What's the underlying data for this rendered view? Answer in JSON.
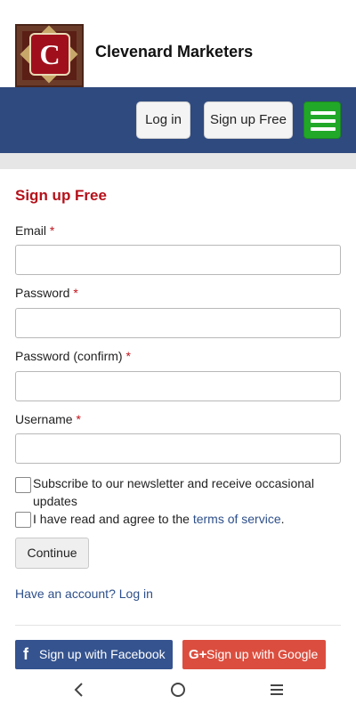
{
  "header": {
    "logo_letter": "C",
    "brand": "Clevenard Marketers",
    "login_label": "Log in",
    "signup_label": "Sign up Free"
  },
  "form": {
    "title": "Sign up Free",
    "required_mark": "*",
    "email_label": "Email",
    "password_label": "Password",
    "password_confirm_label": "Password (confirm)",
    "username_label": "Username",
    "email_value": "",
    "password_value": "",
    "password_confirm_value": "",
    "username_value": "",
    "newsletter_label": "Subscribe to our newsletter and receive occasional updates",
    "terms_prefix": "I have read and agree to the ",
    "terms_link": "terms of service",
    "terms_suffix": ".",
    "continue_label": "Continue",
    "have_account": "Have an account? Log in"
  },
  "social": {
    "facebook_icon": "f",
    "facebook_label": "Sign up with Facebook",
    "google_icon": "G+",
    "google_label": "Sign up with Google"
  },
  "colors": {
    "navbar": "#2f4a7e",
    "accent_red": "#b5101a",
    "menu_green": "#21a828",
    "facebook": "#34538f",
    "google": "#db4e3f",
    "link": "#2d4f8a"
  },
  "icons": [
    "logo-icon",
    "hamburger-icon",
    "facebook-icon",
    "google-plus-icon",
    "back-icon",
    "home-icon",
    "recent-apps-icon"
  ]
}
